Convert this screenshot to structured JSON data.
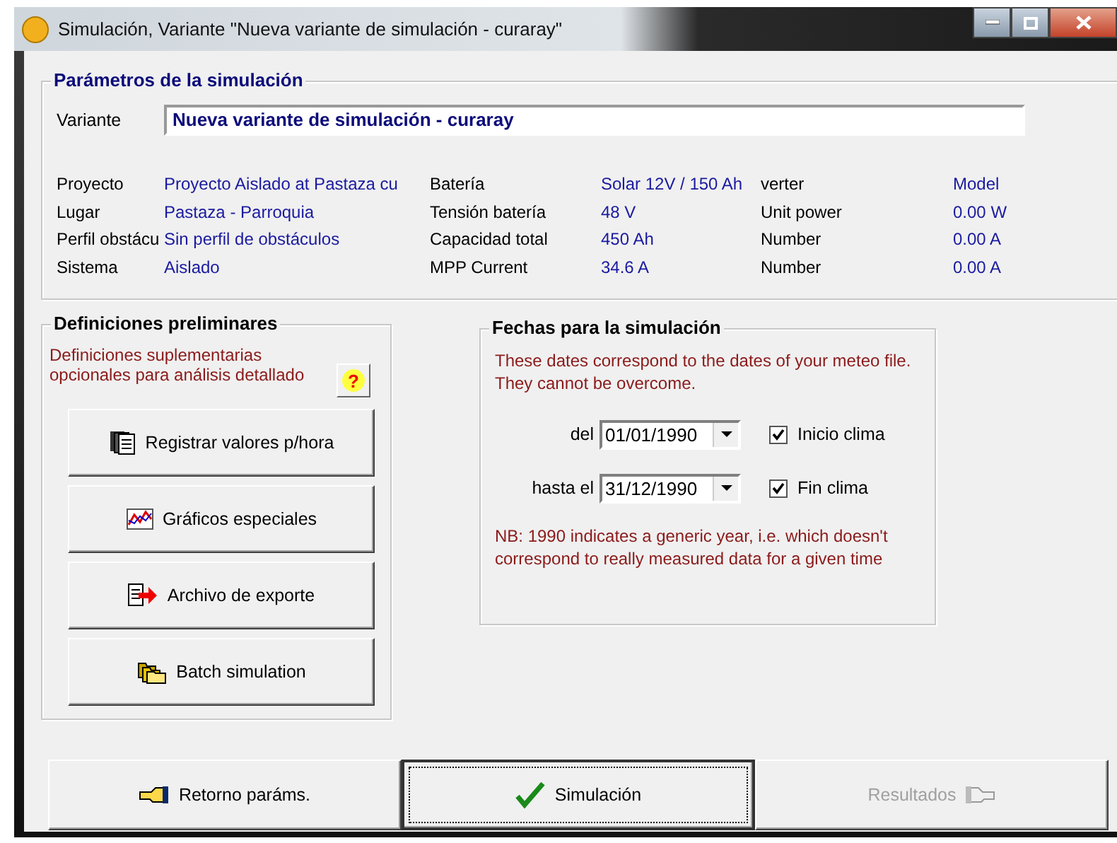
{
  "window": {
    "title": "Simulación, Variante  \"Nueva variante de simulación - curaray\""
  },
  "parameters": {
    "title": "Parámetros de la simulación",
    "variant_label": "Variante",
    "variant_value": "Nueva variante de simulación - curaray",
    "columns": [
      [
        {
          "label": "Proyecto",
          "value": "Proyecto Aislado at Pastaza cu"
        },
        {
          "label": "Lugar",
          "value": "Pastaza - Parroquia"
        },
        {
          "label": "Perfil obstácu",
          "value": "Sin perfil de obstáculos"
        },
        {
          "label": "Sistema",
          "value": "Aislado"
        }
      ],
      [
        {
          "label": "Batería",
          "value": "Solar 12V / 150 Ah"
        },
        {
          "label": "Tensión batería",
          "value": "48  V"
        },
        {
          "label": "Capacidad total",
          "value": "450  Ah"
        },
        {
          "label": "MPP Current",
          "value": "34.6  A"
        }
      ],
      [
        {
          "label": "verter",
          "value": "Model"
        },
        {
          "label": "Unit power",
          "value": "0.00  W"
        },
        {
          "label": "Number",
          "value": "0.00  A"
        },
        {
          "label": "Number",
          "value": "0.00  A"
        }
      ]
    ]
  },
  "preliminary": {
    "title": "Definiciones preliminares",
    "note": "Definiciones suplementarias opcionales para análisis detallado",
    "help": "?",
    "buttons": [
      {
        "label": "Registrar valores p/hora",
        "kind": "log"
      },
      {
        "label": "Gráficos especiales",
        "kind": "chart"
      },
      {
        "label": "Archivo de exporte",
        "kind": "export"
      },
      {
        "label": "Batch simulation",
        "kind": "batch"
      }
    ]
  },
  "dates": {
    "title": "Fechas para la simulación",
    "note": "These dates correspond to the dates of  your meteo file. They cannot be overcome.",
    "rows": [
      {
        "label": "del",
        "value": "01/01/1990",
        "check_label": "Inicio clima",
        "checked": true
      },
      {
        "label": "hasta el",
        "value": "31/12/1990",
        "check_label": "Fin clima",
        "checked": true
      }
    ],
    "footnote": "NB: 1990 indicates a generic year, i.e. which doesn't correspond to really measured data for a given time"
  },
  "footer": [
    {
      "label": "Retorno paráms.",
      "kind": "back",
      "default": false,
      "disabled": false
    },
    {
      "label": "Simulación",
      "kind": "run",
      "default": true,
      "disabled": false
    },
    {
      "label": "Resultados",
      "kind": "results",
      "default": false,
      "disabled": true
    }
  ]
}
